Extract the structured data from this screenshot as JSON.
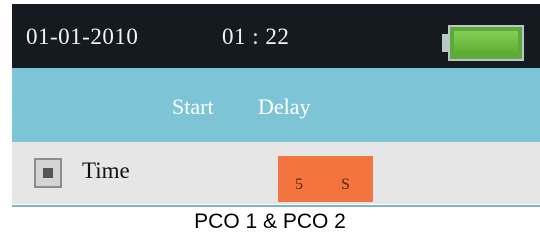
{
  "status_bar": {
    "date": "01-01-2010",
    "time": "01 : 22",
    "battery_level": 1.0
  },
  "title_bar": {
    "word1": "Start",
    "word2": "Delay"
  },
  "setting_row": {
    "label": "Time",
    "value": "5",
    "unit": "S"
  },
  "caption": "PCO 1 & PCO 2",
  "colors": {
    "status_bar_bg": "#141a1f",
    "title_bar_bg": "#7dc4d7",
    "row_bg": "#e6e6e6",
    "value_box_bg": "#f4743f",
    "battery_green": "#6dbd45"
  },
  "icons": {
    "battery": "battery-icon",
    "checkbox": "checkbox-icon"
  }
}
